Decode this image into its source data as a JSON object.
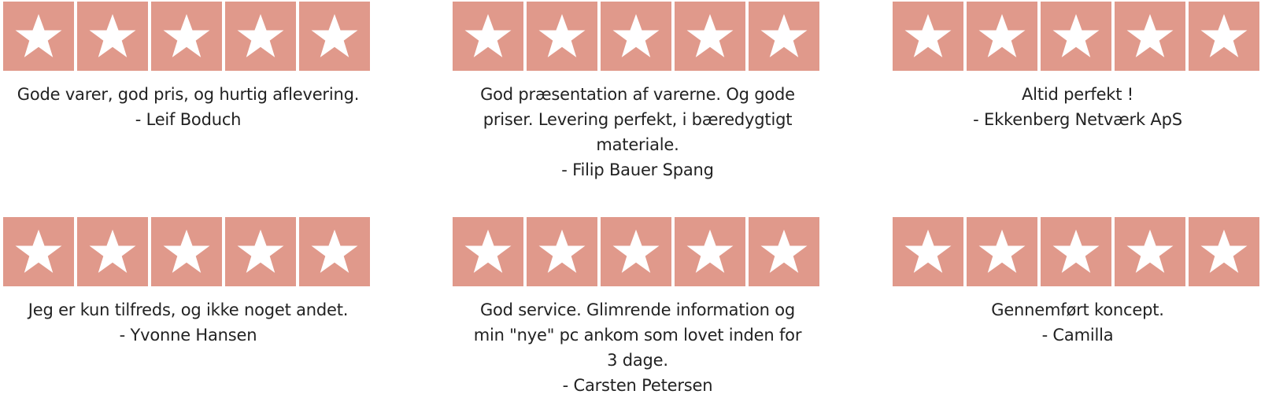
{
  "accent_color": "#e0998b",
  "star_icon": "star-icon",
  "reviews": [
    {
      "rating": 5,
      "text": "Gode varer, god pris, og hurtig aflevering.",
      "author": "- Leif Boduch"
    },
    {
      "rating": 5,
      "text": "God præsentation af varerne. Og gode priser. Levering perfekt, i bæredygtigt materiale.",
      "author": "- Filip Bauer Spang"
    },
    {
      "rating": 5,
      "text": "Altid perfekt !",
      "author": "- Ekkenberg Netværk ApS"
    },
    {
      "rating": 5,
      "text": "Jeg er kun tilfreds, og ikke noget andet.",
      "author": "- Yvonne Hansen"
    },
    {
      "rating": 5,
      "text": "God service.  Glimrende information og min \"nye\" pc ankom som lovet inden for 3 dage.",
      "author": "- Carsten Petersen"
    },
    {
      "rating": 5,
      "text": "Gennemført koncept.",
      "author": "- Camilla"
    }
  ]
}
